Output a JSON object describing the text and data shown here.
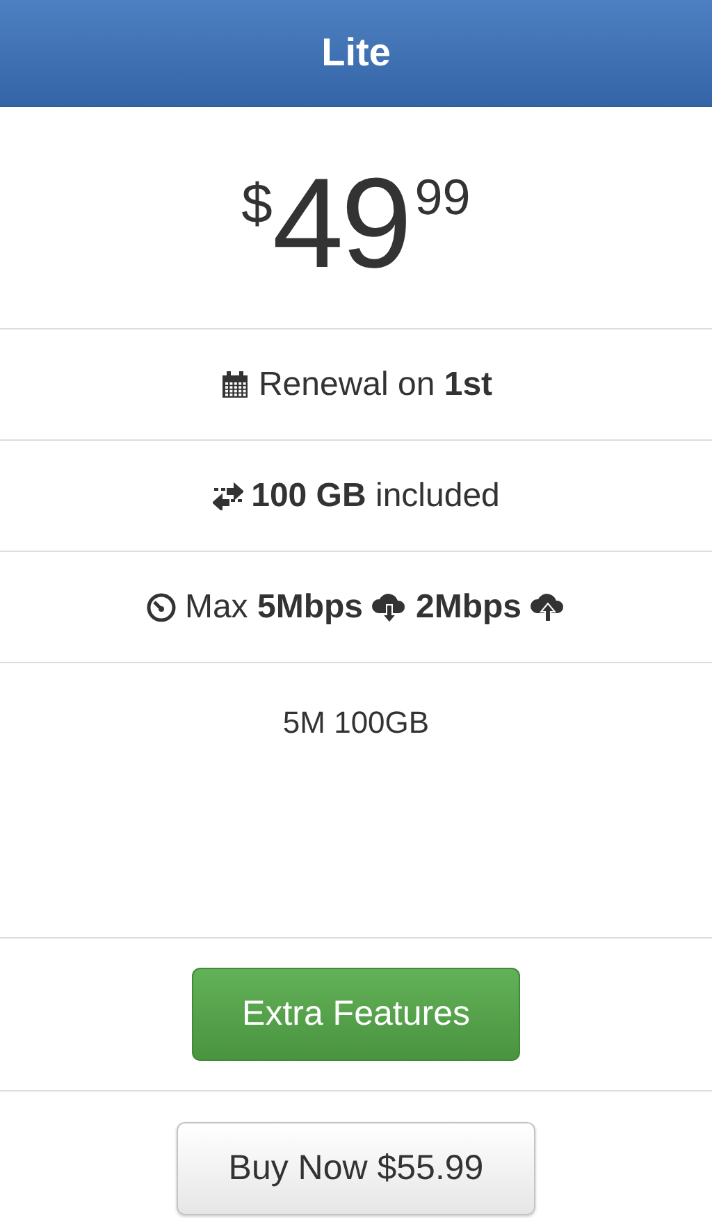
{
  "plan": {
    "title": "Lite",
    "price": {
      "currency": "$",
      "whole": "49",
      "cents": "99"
    }
  },
  "features": [
    {
      "segments": [
        "Renewal on **1st**"
      ]
    },
    {
      "segments": [
        "**100 GB** included"
      ]
    },
    {
      "segments": [
        "Max **5Mbps**",
        "**2Mbps**"
      ]
    }
  ],
  "description": "5M 100GB",
  "buttons": [
    {
      "label": "Extra Features",
      "kind": "primary"
    },
    {
      "label": "Buy Now $55.99",
      "kind": "default"
    }
  ]
}
